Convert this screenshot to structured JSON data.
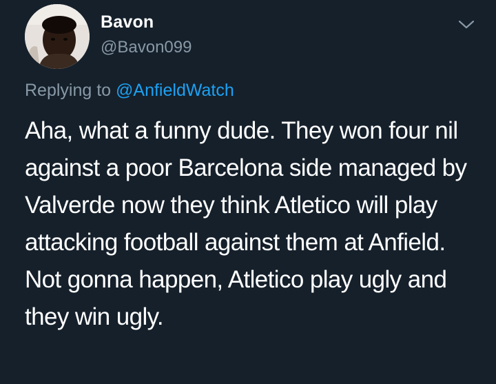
{
  "author": {
    "display_name": "Bavon",
    "handle": "@Bavon099"
  },
  "reply": {
    "prefix": "Replying to",
    "handle": "@AnfieldWatch"
  },
  "tweet": {
    "text": "Aha, what a funny dude. They won four nil against a poor Barcelona side managed by Valverde now they think Atletico will play attacking football against them at Anfield. Not gonna happen, Atletico play ugly and they win ugly."
  },
  "icons": {
    "menu": "chevron-down-icon",
    "avatar": "profile-photo"
  },
  "colors": {
    "background": "#15202b",
    "primary_text": "#ffffff",
    "secondary_text": "#8899a6",
    "link": "#1da1f2"
  }
}
